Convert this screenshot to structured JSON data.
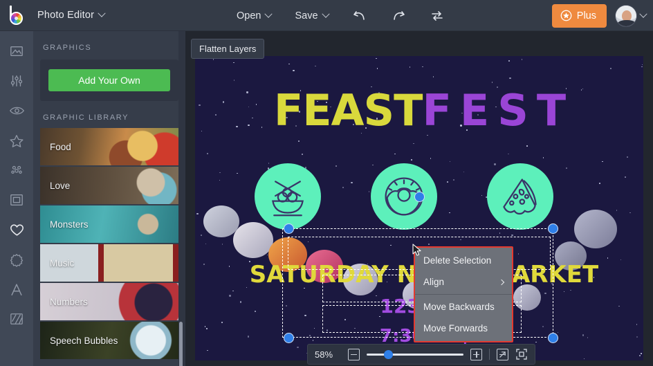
{
  "app": {
    "logo_icon": "color-wheel-logo",
    "title": "Photo Editor",
    "title_caret": "chevron-down-icon"
  },
  "toolbar": {
    "open_label": "Open",
    "save_label": "Save",
    "undo_icon": "undo-arrow-icon",
    "redo_icon": "redo-arrow-icon",
    "swap_icon": "swap-arrows-icon",
    "plus_label": "Plus",
    "plus_icon": "star-badge-icon",
    "plus_color": "#ef8a3f",
    "avatar_icon": "user-avatar",
    "avatar_caret": "chevron-down-icon"
  },
  "rail": {
    "items": [
      {
        "icon": "image-icon",
        "active": false
      },
      {
        "icon": "sliders-adjust-icon",
        "active": false
      },
      {
        "icon": "eye-icon",
        "active": false
      },
      {
        "icon": "star-icon",
        "active": false
      },
      {
        "icon": "particles-icon",
        "active": false
      },
      {
        "icon": "frame-icon",
        "active": false
      },
      {
        "icon": "heart-icon",
        "active": true
      },
      {
        "icon": "flower-badge-icon",
        "active": false
      },
      {
        "icon": "text-a-icon",
        "active": false
      },
      {
        "icon": "texture-stripes-icon",
        "active": false
      }
    ]
  },
  "panel": {
    "graphics_label": "GRAPHICS",
    "add_own_label": "Add Your Own",
    "add_own_color": "#4cbb52",
    "library_label": "GRAPHIC LIBRARY",
    "library_items": [
      {
        "name": "Food",
        "thumb": "food-photo"
      },
      {
        "name": "Love",
        "thumb": "love-photo"
      },
      {
        "name": "Monsters",
        "thumb": "monsters-photo"
      },
      {
        "name": "Music",
        "thumb": "music-photo"
      },
      {
        "name": "Numbers",
        "thumb": "numbers-photo"
      },
      {
        "name": "Speech Bubbles",
        "thumb": "speech-bubbles-photo"
      }
    ]
  },
  "stage": {
    "flatten_label": "Flatten Layers"
  },
  "design": {
    "background_color": "#1b1840",
    "headline_part1": "FEAST",
    "headline_part1_color": "#d9d93c",
    "headline_part2": "FEST",
    "headline_part2_color": "#9a45d6",
    "badges": [
      {
        "icon": "noodle-bowl-icon",
        "color": "#5df0bb"
      },
      {
        "icon": "donut-icon",
        "color": "#5df0bb"
      },
      {
        "icon": "pizza-slice-icon",
        "color": "#5df0bb"
      }
    ],
    "line2": "SATURDAY NIGHT MARKET",
    "line2_color": "#e0d93b",
    "line3": "1234 SE",
    "line3_color": "#a24ce0",
    "line4": "7:30PM  |",
    "line4_color": "#a24ce0"
  },
  "context_menu": {
    "border_color": "#e4392f",
    "items": [
      {
        "label": "Delete Selection",
        "has_submenu": false
      },
      {
        "label": "Align",
        "has_submenu": true,
        "arrow_icon": "chevron-right-icon"
      },
      {
        "label": "Move Backwards",
        "has_submenu": false
      },
      {
        "label": "Move Forwards",
        "has_submenu": false
      }
    ]
  },
  "zoombar": {
    "zoom_level": "58%",
    "zoom_out_icon": "minus-square-icon",
    "zoom_in_icon": "plus-square-icon",
    "slider_percent": 22,
    "expand_icon": "expand-diagonal-icon",
    "fit_icon": "fit-to-screen-icon"
  }
}
